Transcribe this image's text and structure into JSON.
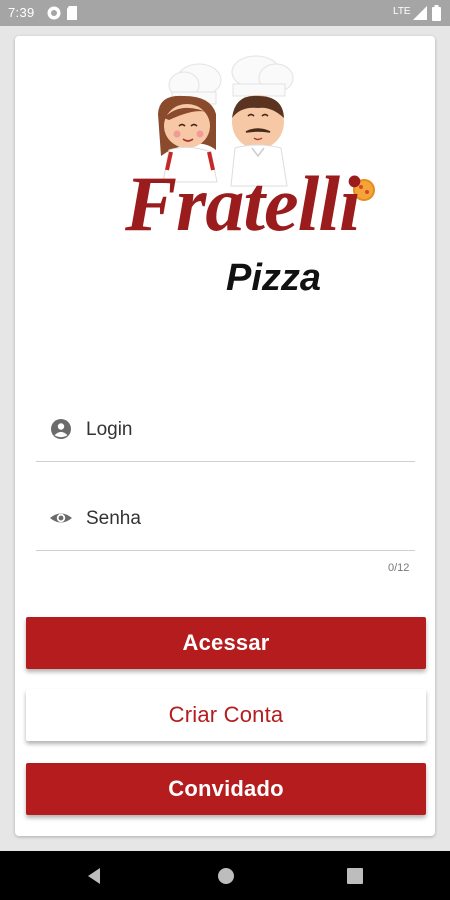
{
  "status_bar": {
    "time": "7:39",
    "network": "LTE"
  },
  "brand": {
    "name": "Fratelli",
    "subtitle": "Pizza"
  },
  "form": {
    "login_label": "Login",
    "password_label": "Senha",
    "password_counter": "0/12"
  },
  "buttons": {
    "access": "Acessar",
    "create_account": "Criar Conta",
    "guest": "Convidado"
  },
  "colors": {
    "primary": "#b51c1e",
    "brand_red": "#9b1c1c"
  }
}
